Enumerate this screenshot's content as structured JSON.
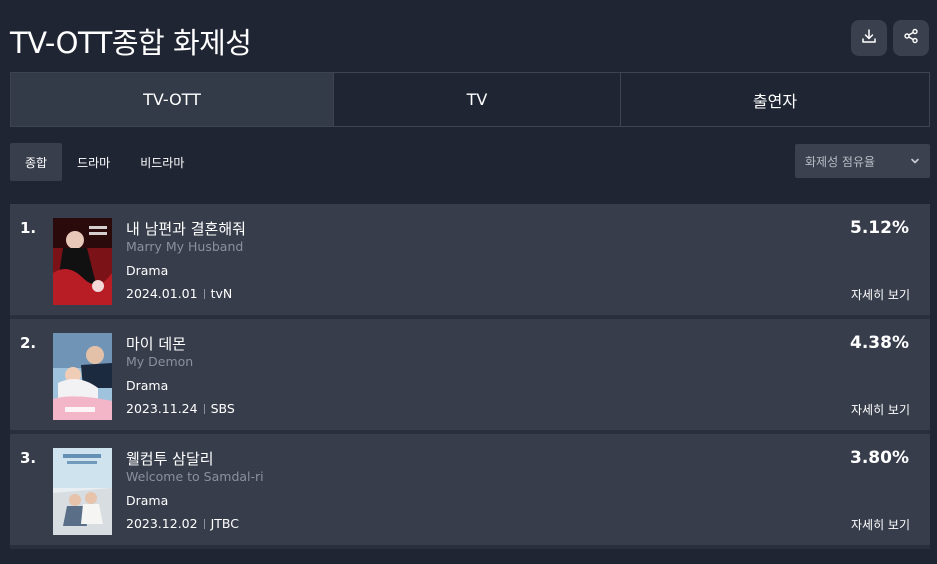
{
  "header": {
    "title": "TV-OTT종합 화제성"
  },
  "icons": {
    "download": "download-icon",
    "share": "share-icon",
    "dropdown": "chevron-down-icon"
  },
  "main_tabs": [
    {
      "label": "TV-OTT",
      "active": true
    },
    {
      "label": "TV",
      "active": false
    },
    {
      "label": "출연자",
      "active": false
    }
  ],
  "sub_tabs": [
    {
      "label": "종합",
      "active": true
    },
    {
      "label": "드라마",
      "active": false
    },
    {
      "label": "비드라마",
      "active": false
    }
  ],
  "sort": {
    "selected": "화제성 점유율"
  },
  "rankings": [
    {
      "rank": "1.",
      "title_ko": "내 남편과 결혼해줘",
      "title_en": "Marry My Husband",
      "genre": "Drama",
      "date": "2024.01.01",
      "channel": "tvN",
      "share": "5.12%",
      "detail_label": "자세히 보기"
    },
    {
      "rank": "2.",
      "title_ko": "마이 데몬",
      "title_en": "My Demon",
      "genre": "Drama",
      "date": "2023.11.24",
      "channel": "SBS",
      "share": "4.38%",
      "detail_label": "자세히 보기"
    },
    {
      "rank": "3.",
      "title_ko": "웰컴투 삼달리",
      "title_en": "Welcome to Samdal-ri",
      "genre": "Drama",
      "date": "2023.12.02",
      "channel": "JTBC",
      "share": "3.80%",
      "detail_label": "자세히 보기"
    }
  ],
  "colors": {
    "background": "#1f2533",
    "card": "#373d4b",
    "active_tab": "#333a48",
    "muted_text": "#8a909c"
  }
}
